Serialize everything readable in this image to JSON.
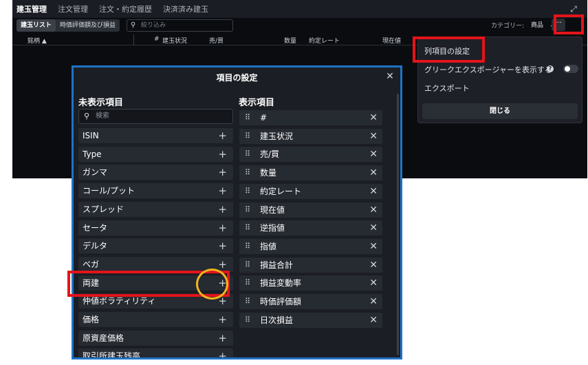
{
  "nav": {
    "tabs": [
      "建玉管理",
      "注文管理",
      "注文・約定履歴",
      "決済済み建玉"
    ],
    "expand_icon": "expand-icon"
  },
  "toolbar": {
    "segment": [
      "建玉リスト",
      "時価評価額及び損益"
    ],
    "filter_placeholder": "絞り込み",
    "category_label": "カテゴリー:",
    "category_value": "商品",
    "more_label": "···"
  },
  "columns": {
    "symbol": "銘柄 ▲",
    "num": "#",
    "status": "建玉状況",
    "side": "売/買",
    "qty": "数量",
    "rate": "約定レート",
    "current": "現在値"
  },
  "menu": {
    "items": [
      "列項目の設定",
      "グリークエクスポージャーを表示する",
      "エクスポート"
    ],
    "help": "?",
    "close_label": "閉じる"
  },
  "modal": {
    "title": "項目の設定",
    "hidden_title": "未表示項目",
    "shown_title": "表示項目",
    "search_placeholder": "検索",
    "hidden_items": [
      "ISIN",
      "Type",
      "ガンマ",
      "コール/プット",
      "スプレッド",
      "セータ",
      "デルタ",
      "ベガ",
      "両建",
      "仲値ボラティリティ",
      "価格",
      "原資産価格",
      "取引所建玉残高"
    ],
    "shown_items": [
      "#",
      "建玉状況",
      "売/買",
      "数量",
      "約定レート",
      "現在値",
      "逆指値",
      "指値",
      "損益合計",
      "損益変動率",
      "時価評価額",
      "日次損益"
    ],
    "add_symbol": "+",
    "remove_symbol": "✕",
    "grip_symbol": "⠿"
  },
  "colors": {
    "accent": "#1e73c8",
    "highlight_red": "#e3141b",
    "highlight_yellow": "#f2b51f"
  }
}
